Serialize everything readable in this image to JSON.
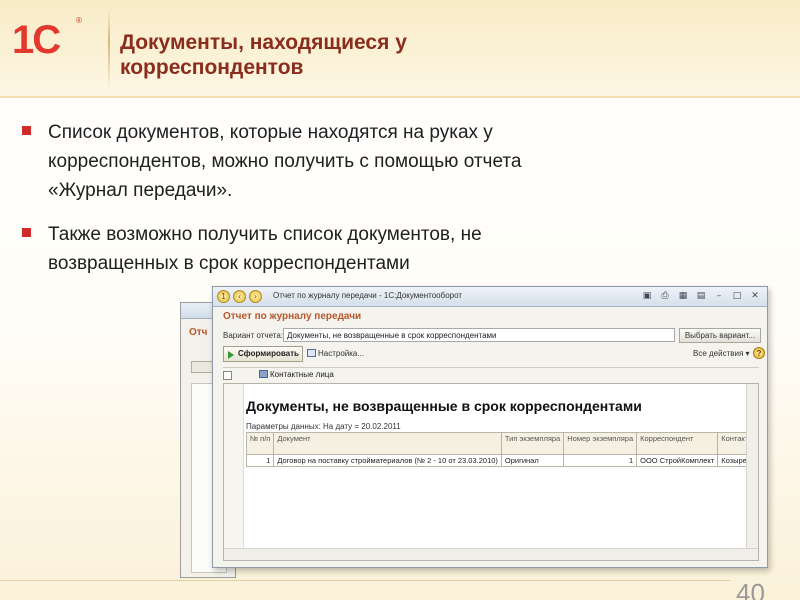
{
  "slide": {
    "logo": "1С",
    "logo_reg": "®",
    "title": "Документы, находящиеся у корреспондентов",
    "bullets": [
      "Список документов, которые находятся на руках у корреспондентов, можно получить с помощью отчета «Журнал передачи».",
      "Также возможно получить список документов, не возвращенных в срок корреспондентами"
    ],
    "page_number": "40"
  },
  "window": {
    "title": "Отчет по журналу передачи - 1С:Документооборот",
    "report_title": "Отчет по журналу передачи",
    "variant_label": "Вариант отчета:",
    "variant_value": "Документы, не возвращенные в срок корреспондентами",
    "choose_variant": "Выбрать вариант...",
    "form_button": "Сформировать",
    "settings": "Настройка...",
    "all_actions": "Все действия ▾",
    "contacts": "Контактные лица",
    "help": "?"
  },
  "back_window": {
    "label": "Отч"
  },
  "report": {
    "heading": "Документы, не возвращенные в срок корреспондентами",
    "params": "Параметры данных:     На дату = 20.02.2011",
    "columns": [
      "№ п/п",
      "Документ",
      "Тип экземпляра",
      "Номер экземпляра",
      "Корреспондент",
      "Контактное лицо"
    ],
    "rows": [
      [
        "1",
        "Договор на поставку стройматериалов (№ 2 - 10 от 23.03.2010)",
        "Оригинал",
        "1",
        "ООО СтройКомплект",
        "Козырев А.Д."
      ]
    ]
  }
}
